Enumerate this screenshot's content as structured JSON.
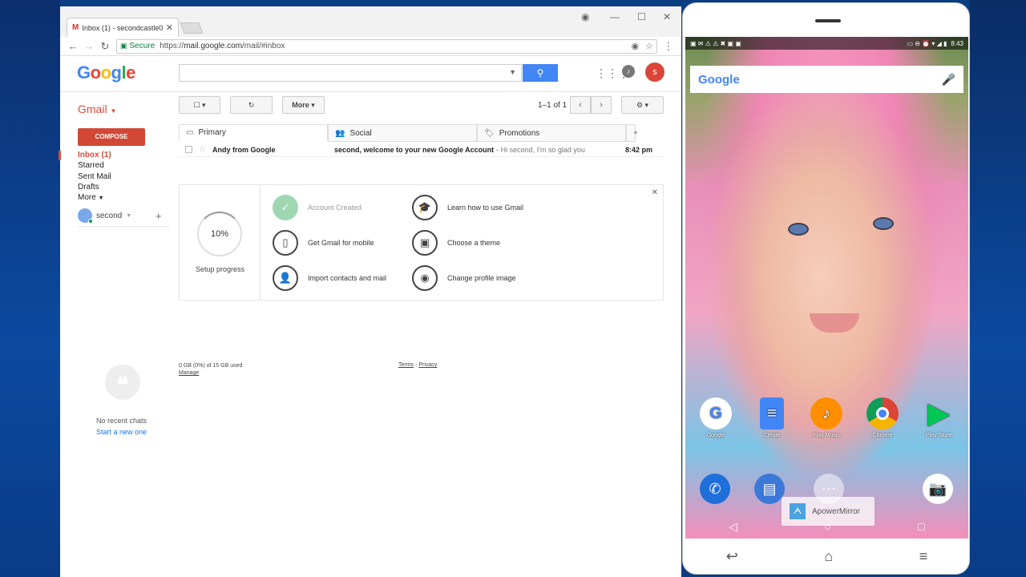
{
  "browser": {
    "tab_title": "Inbox (1) - secondcastle0",
    "tab_favicon": "M",
    "tab_close": "✕",
    "secure_label": "Secure",
    "url_scheme": "https://",
    "url_host": "mail.google.com",
    "url_path": "/mail/#inbox"
  },
  "gmail": {
    "logo": "Google",
    "app_label": "Gmail",
    "avatar_letter": "s",
    "toolbar": {
      "more_label": "More"
    },
    "pager_text": "1–1 of 1",
    "compose_label": "COMPOSE",
    "nav": {
      "inbox": "Inbox (1)",
      "starred": "Starred",
      "sent": "Sent Mail",
      "drafts": "Drafts",
      "more": "More"
    },
    "account_name": "second",
    "tabs": {
      "primary": "Primary",
      "social": "Social",
      "promotions": "Promotions"
    },
    "message": {
      "sender": "Andy from Google",
      "subject": "second, welcome to your new Google Account",
      "snippet": "- Hi second, I'm so glad you",
      "time": "8:42 pm"
    },
    "setup": {
      "progress": "10%",
      "label": "Setup progress",
      "tasks": {
        "account_created": "Account Created",
        "learn_gmail": "Learn how to use Gmail",
        "gmail_mobile": "Get Gmail for mobile",
        "choose_theme": "Choose a theme",
        "import_contacts": "Import contacts and mail",
        "profile_image": "Change profile image"
      }
    },
    "footer": {
      "storage": "0 GB (0%) of 15 GB used",
      "manage": "Manage",
      "terms": "Terms",
      "separator": "-",
      "privacy": "Privacy"
    },
    "chat": {
      "no_chats": "No recent chats",
      "start_new": "Start a new one"
    }
  },
  "phone": {
    "time": "8:43",
    "search_logo": "Google",
    "apps": {
      "google": "Google",
      "create": "Create",
      "play_music": "Play Music",
      "chrome": "Chrome",
      "play_store": "Play Store"
    },
    "apowermirror": "ApowerMirror"
  }
}
